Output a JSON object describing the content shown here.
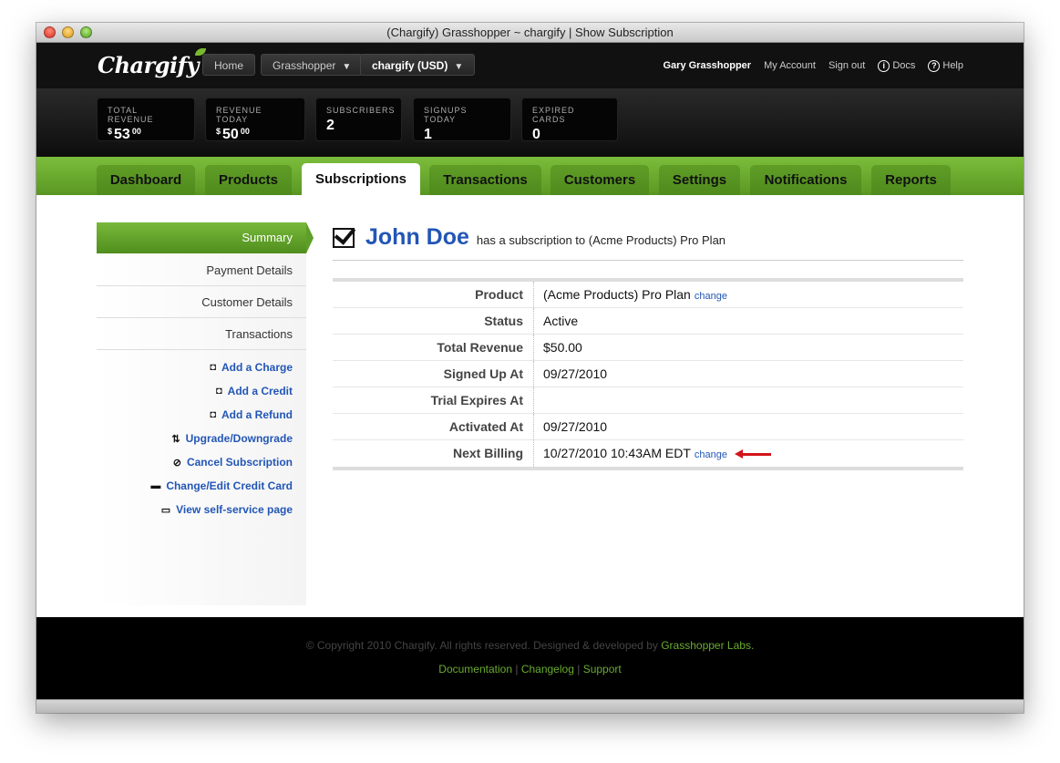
{
  "window": {
    "title": "(Chargify) Grasshopper ~ chargify | Show Subscription"
  },
  "topbar": {
    "logo": "Chargify",
    "home_label": "Home",
    "site_select": "Grasshopper",
    "currency_select": "chargify (USD)",
    "user_name": "Gary Grasshopper",
    "my_account": "My Account",
    "sign_out": "Sign out",
    "docs": "Docs",
    "help": "Help"
  },
  "stats": [
    {
      "label": "TOTAL REVENUE",
      "currency": "$",
      "value": "53",
      "cents": "00"
    },
    {
      "label": "REVENUE TODAY",
      "currency": "$",
      "value": "50",
      "cents": "00"
    },
    {
      "label": "SUBSCRIBERS",
      "value": "2"
    },
    {
      "label": "SIGNUPS TODAY",
      "value": "1"
    },
    {
      "label": "EXPIRED CARDS",
      "value": "0"
    }
  ],
  "tabs": [
    "Dashboard",
    "Products",
    "Subscriptions",
    "Transactions",
    "Customers",
    "Settings",
    "Notifications",
    "Reports"
  ],
  "active_tab": "Subscriptions",
  "sidebar": {
    "active": "Summary",
    "items": [
      "Payment Details",
      "Customer Details",
      "Transactions"
    ],
    "actions": [
      "Add a Charge",
      "Add a Credit",
      "Add a Refund",
      "Upgrade/Downgrade",
      "Cancel Subscription",
      "Change/Edit Credit Card",
      "View self-service page"
    ]
  },
  "subscription": {
    "customer_name": "John Doe",
    "description": "has a subscription to (Acme Products) Pro Plan",
    "change_label": "change",
    "rows": [
      {
        "label": "Product",
        "value": "(Acme Products) Pro Plan"
      },
      {
        "label": "Status",
        "value": "Active"
      },
      {
        "label": "Total Revenue",
        "value": "$50.00"
      },
      {
        "label": "Signed Up At",
        "value": "09/27/2010"
      },
      {
        "label": "Trial Expires At",
        "value": ""
      },
      {
        "label": "Activated At",
        "value": "09/27/2010"
      },
      {
        "label": "Next Billing",
        "value": "10/27/2010 10:43AM EDT"
      }
    ]
  },
  "footer": {
    "copyright": "© Copyright 2010 Chargify. All rights reserved. Designed & developed by",
    "company": "Grasshopper Labs.",
    "links": [
      "Documentation",
      "Changelog",
      "Support"
    ],
    "separator": "|"
  }
}
